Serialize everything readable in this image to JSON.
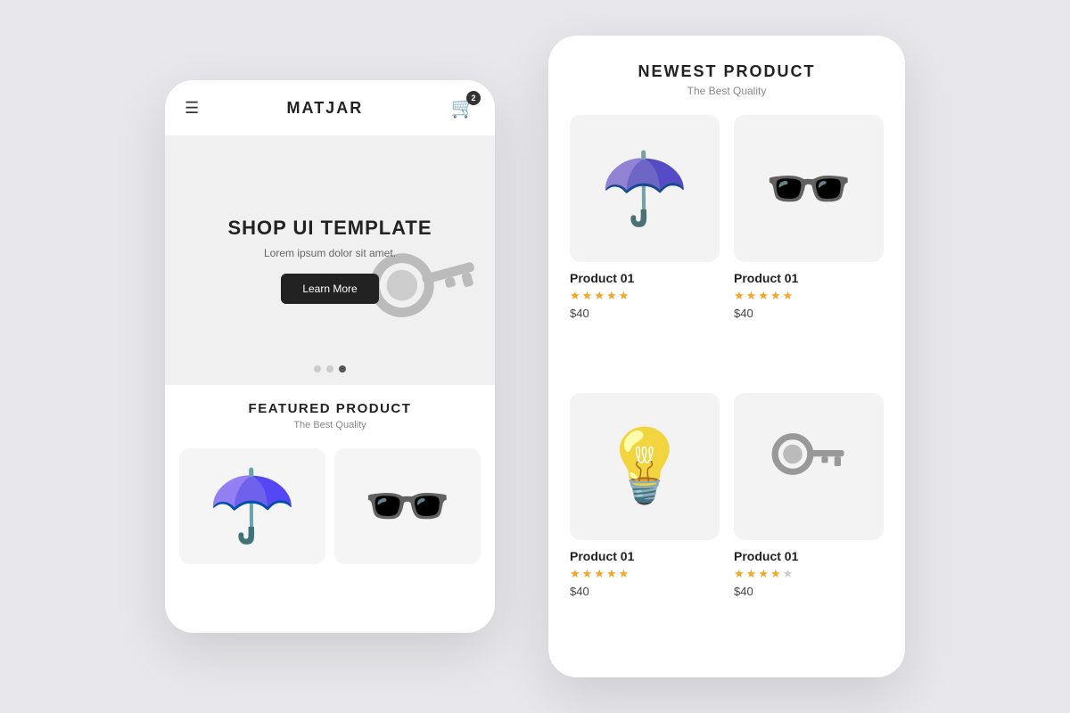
{
  "left_phone": {
    "header": {
      "logo": "MATJAR",
      "cart_badge": "2"
    },
    "hero": {
      "title": "SHOP UI TEMPLATE",
      "subtitle": "Lorem ipsum dolor sit amet.",
      "button_label": "Learn More",
      "dots": [
        false,
        false,
        true
      ]
    },
    "featured": {
      "section_title": "FEATURED PRODUCT",
      "section_subtitle": "The Best Quality"
    }
  },
  "right_panel": {
    "title": "NEWEST PRODUCT",
    "subtitle": "The Best Quality",
    "products": [
      {
        "name": "Product 01",
        "price": "$40",
        "stars": [
          true,
          true,
          true,
          true,
          true
        ],
        "emoji": "☂️",
        "type": "umbrella"
      },
      {
        "name": "Product 01",
        "price": "$40",
        "stars": [
          true,
          true,
          true,
          true,
          true
        ],
        "emoji": "🕶️",
        "type": "sunglasses"
      },
      {
        "name": "Product 01",
        "price": "$40",
        "stars": [
          true,
          true,
          true,
          true,
          true
        ],
        "emoji": "💡",
        "type": "bulb"
      },
      {
        "name": "Product 01",
        "price": "$40",
        "stars": [
          true,
          true,
          true,
          true,
          false
        ],
        "emoji": "🔑",
        "type": "key"
      }
    ]
  }
}
